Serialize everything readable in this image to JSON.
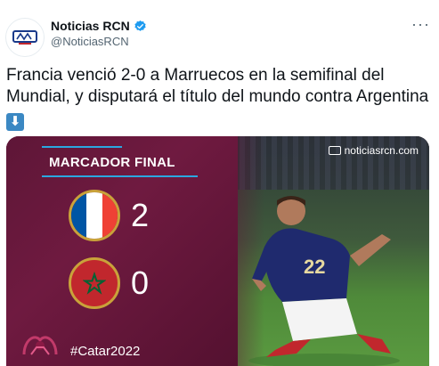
{
  "account": {
    "display_name": "Noticias RCN",
    "handle": "@NoticiasRCN",
    "avatar_icon": "rcn-logo-icon",
    "verified_icon": "verified-badge-icon",
    "more_icon": "more-options-icon",
    "more_glyph": "···"
  },
  "tweet": {
    "text": "Francia venció 2-0 a Marruecos en la semifinal del Mundial, y disputará el título del mundo contra Argentina",
    "emoji_glyph": "⬇",
    "emoji_icon": "down-arrow-emoji-icon"
  },
  "media": {
    "title": "MARCADOR FINAL",
    "brand": "noticiasrcn.com",
    "teams": [
      {
        "flag_icon": "france-flag-icon",
        "score": "2"
      },
      {
        "flag_icon": "morocco-flag-icon",
        "score": "0"
      }
    ],
    "hashtag": "#Catar2022",
    "jersey_number": "22"
  },
  "colors": {
    "accent_blue": "#1d9bf0",
    "panel_maroon": "#5e1637",
    "gold_ring": "#c9a23a"
  }
}
